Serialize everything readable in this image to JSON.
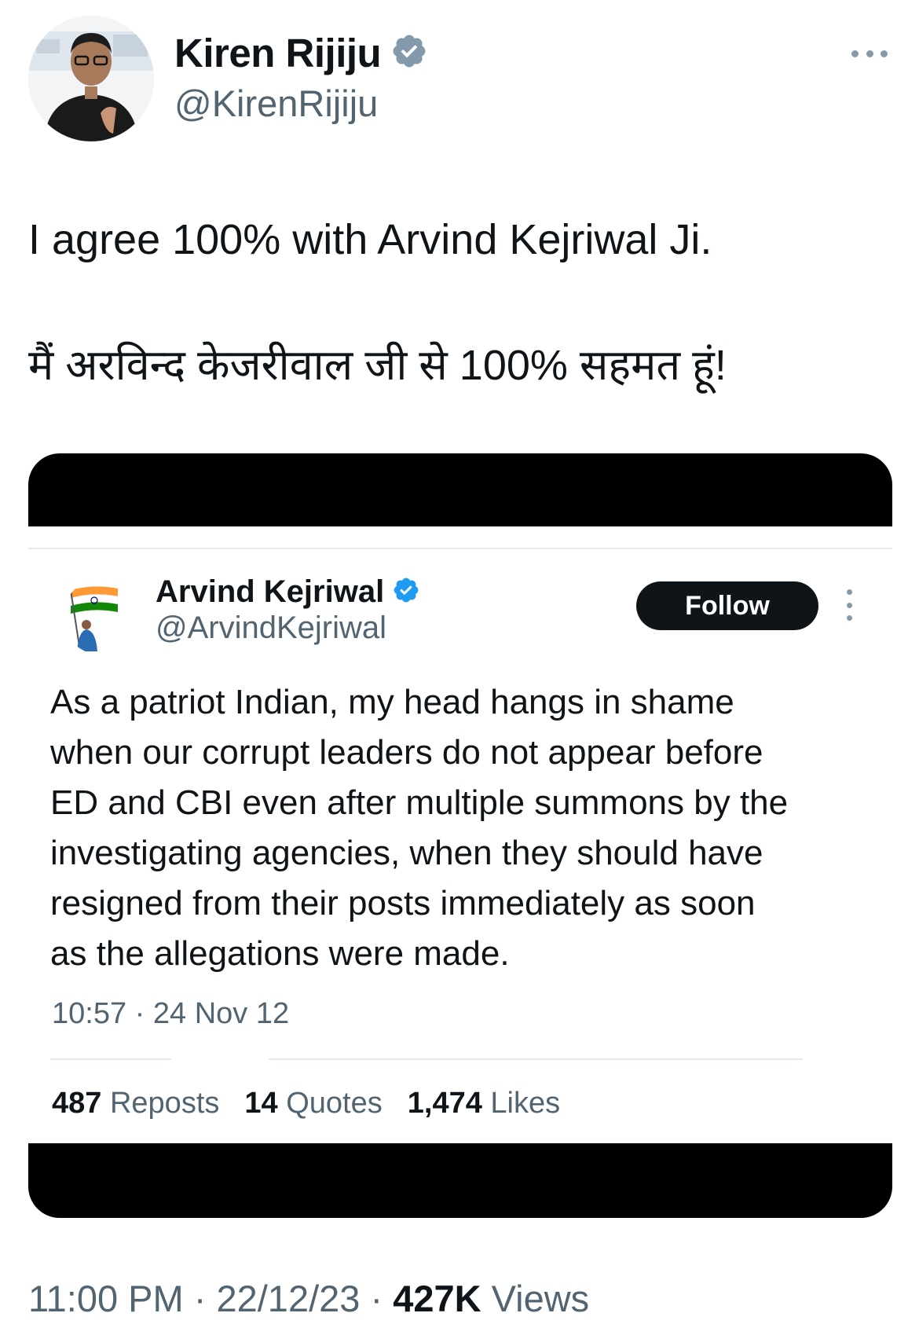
{
  "tweet": {
    "author_name": "Kiren Rijiju",
    "author_handle": "@KirenRijiju",
    "text_line1": "I agree 100% with Arvind Kejriwal Ji.",
    "text_line2": "मैं अरविन्द केजरीवाल जी से 100% सहमत हूं!",
    "time": "11:00 PM",
    "separator": "·",
    "date": "22/12/23",
    "views_count": "427K",
    "views_label": "Views"
  },
  "quoted_tweet": {
    "author_name": "Arvind Kejriwal",
    "author_handle": "@ArvindKejriwal",
    "follow_label": "Follow",
    "text_lines": [
      "As a patriot Indian, my head hangs in shame",
      "when our corrupt leaders do not appear before",
      "ED and CBI even after multiple summons by the",
      "investigating agencies, when they should have",
      "resigned from their posts immediately as soon",
      "as the allegations were made."
    ],
    "timestamp": "10:57 · 24 Nov 12",
    "reposts_count": "487",
    "reposts_label": "Reposts",
    "quotes_count": "14",
    "quotes_label": "Quotes",
    "likes_count": "1,474",
    "likes_label": "Likes"
  },
  "colors": {
    "text_primary": "#0f1419",
    "text_secondary": "#536471",
    "verified_blue": "#1d9bf0",
    "verified_gray": "#829aab",
    "redaction": "#000000"
  },
  "icons": {
    "outer_verified": "verified-badge-gray",
    "inner_verified": "verified-badge-blue",
    "more": "more-horizontal",
    "kebab": "more-vertical"
  }
}
